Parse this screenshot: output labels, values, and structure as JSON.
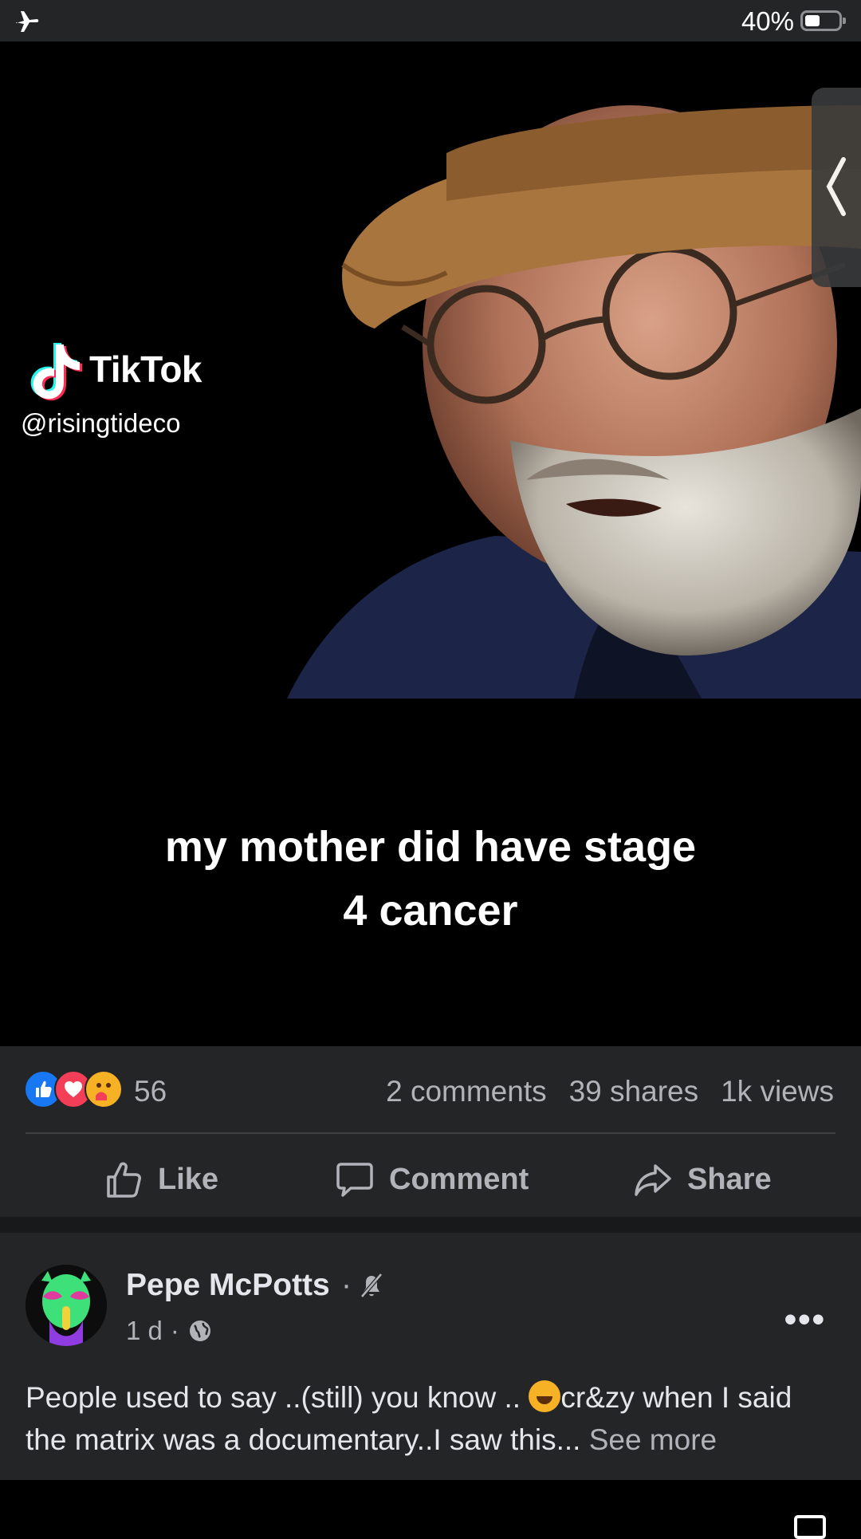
{
  "status_bar": {
    "battery_percent": "40%",
    "battery_level": 0.4,
    "airplane_icon": "airplane-icon"
  },
  "video": {
    "watermark": {
      "brand": "TikTok",
      "handle": "@risingtideco"
    },
    "subtitle_line1": "my mother did have stage",
    "subtitle_line2": "4 cancer"
  },
  "engagement": {
    "reaction_icons": [
      "like-reaction-icon",
      "love-reaction-icon",
      "care-reaction-icon"
    ],
    "reaction_count": "56",
    "comments": "2 comments",
    "shares": "39 shares",
    "views": "1k views",
    "actions": {
      "like": "Like",
      "comment": "Comment",
      "share": "Share"
    }
  },
  "next_post": {
    "author": "Pepe McPotts",
    "separator": "·",
    "time": "1 d",
    "text": "People used to say ..(still) you know .. ",
    "text_after_emoji": "cr&zy when I said the matrix was a documentary..I saw this...",
    "see_more": "See more"
  },
  "colors": {
    "surface": "#242526",
    "text": "#e4e6eb",
    "muted": "#b0b3b8",
    "like_blue": "#1877f2",
    "love_red": "#f33e58"
  }
}
